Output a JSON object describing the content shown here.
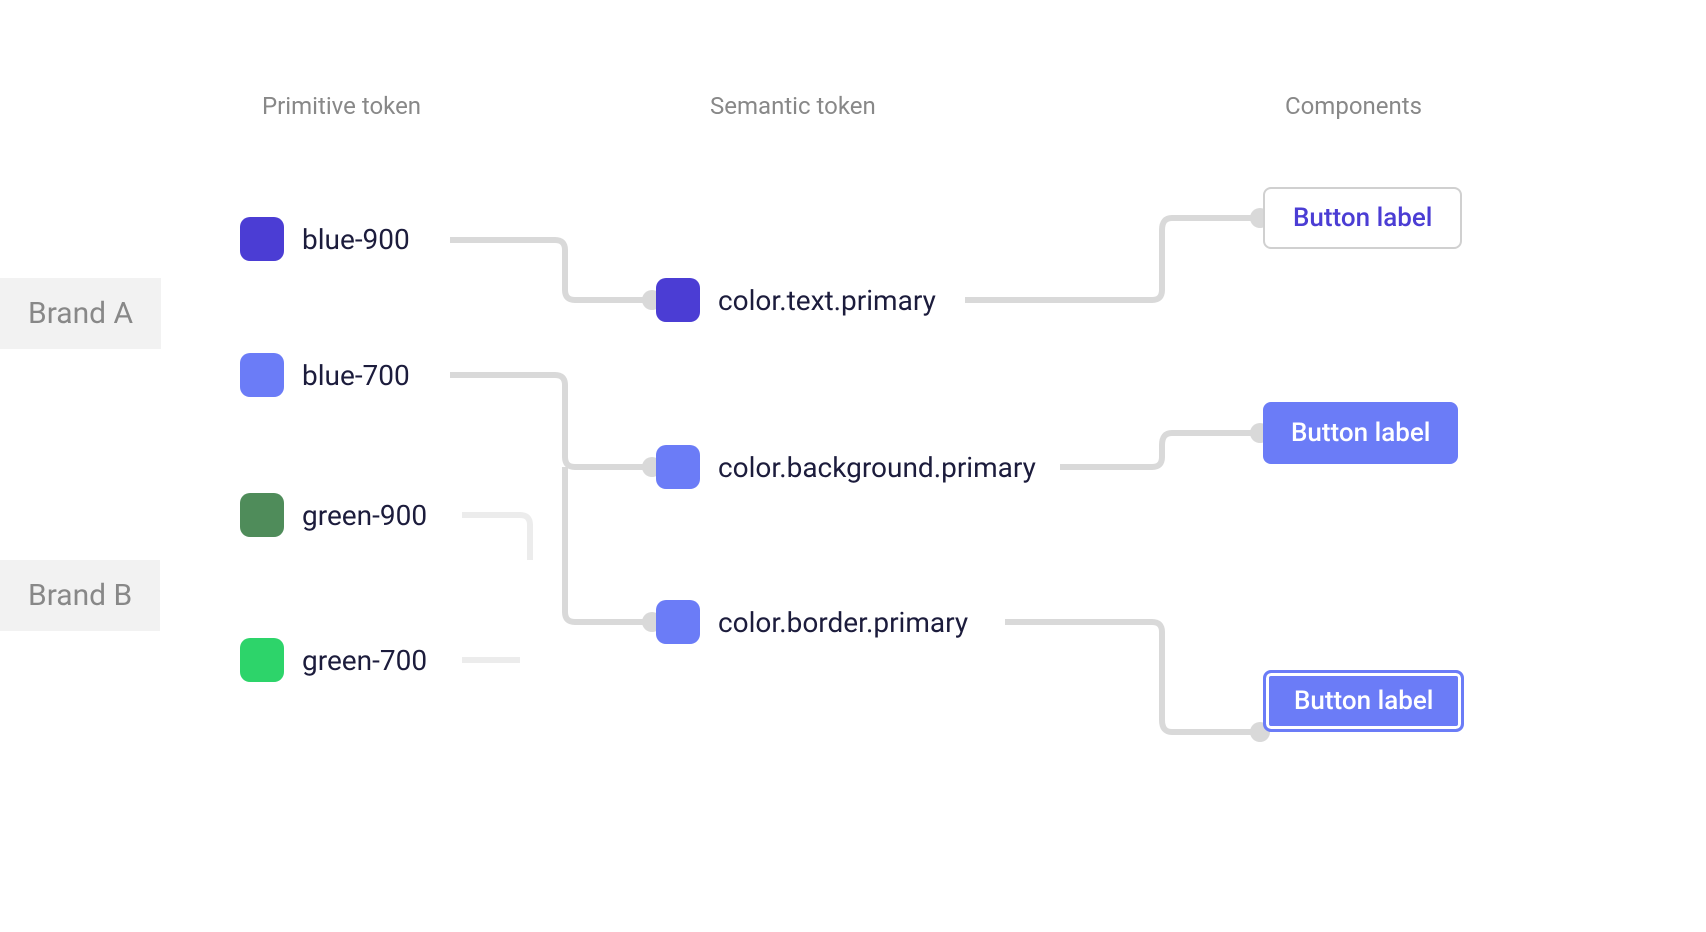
{
  "headers": {
    "primitive": "Primitive token",
    "semantic": "Semantic token",
    "components": "Components"
  },
  "brands": {
    "a": "Brand A",
    "b": "Brand B"
  },
  "primitives": {
    "blue900": {
      "label": "blue-900",
      "color": "#4b3dd4"
    },
    "blue700": {
      "label": "blue-700",
      "color": "#6b7cf7"
    },
    "green900": {
      "label": "green-900",
      "color": "#4f8c5a"
    },
    "green700": {
      "label": "green-700",
      "color": "#2dd46a"
    }
  },
  "semantic": {
    "textPrimary": {
      "label": "color.text.primary",
      "color": "#4b3dd4"
    },
    "bgPrimary": {
      "label": "color.background.primary",
      "color": "#6b7cf7"
    },
    "borderPrimary": {
      "label": "color.border.primary",
      "color": "#6b7cf7"
    }
  },
  "components": {
    "button1": "Button label",
    "button2": "Button label",
    "button3": "Button label"
  }
}
